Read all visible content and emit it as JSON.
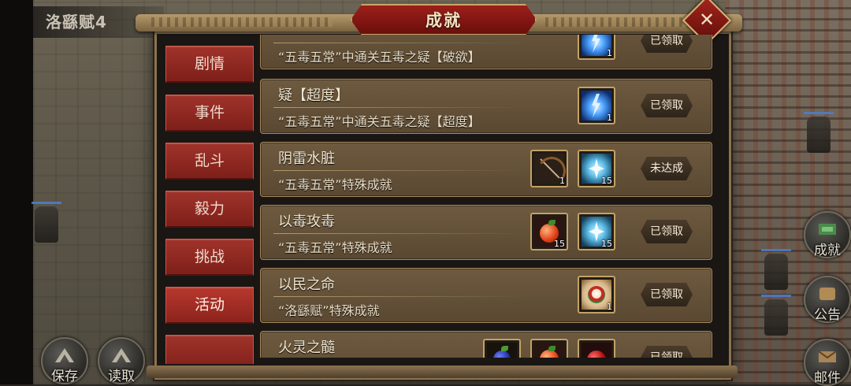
{
  "hud": {
    "map_title": "洛繇赋4",
    "save_label": "保存",
    "load_label": "读取",
    "achievement_label": "成就",
    "notice_label": "公告",
    "mail_label": "邮件"
  },
  "dialog": {
    "title": "成就",
    "close_icon": "close-x"
  },
  "tabs": [
    {
      "label": "剧情",
      "active": false
    },
    {
      "label": "事件",
      "active": false
    },
    {
      "label": "乱斗",
      "active": false
    },
    {
      "label": "毅力",
      "active": false
    },
    {
      "label": "挑战",
      "active": false
    },
    {
      "label": "活动",
      "active": true
    },
    {
      "label": "",
      "active": false
    }
  ],
  "achievements": [
    {
      "name": "",
      "desc": "“五毒五常”中通关五毒之疑【破欲】",
      "rewards": [
        {
          "icon": "lightning-icon",
          "count": "1"
        }
      ],
      "status": "已领取"
    },
    {
      "name": "疑【超度】",
      "desc": "“五毒五常”中通关五毒之疑【超度】",
      "rewards": [
        {
          "icon": "lightning-icon",
          "count": "1"
        }
      ],
      "status": "已领取"
    },
    {
      "name": "阴雷水脏",
      "desc": "“五毒五常”特殊成就",
      "rewards": [
        {
          "icon": "bow-icon",
          "count": "1"
        },
        {
          "icon": "crystal-icon",
          "count": "15"
        }
      ],
      "status": "未达成"
    },
    {
      "name": "以毒攻毒",
      "desc": "“五毒五常”特殊成就",
      "rewards": [
        {
          "icon": "fruit-icon",
          "count": "15"
        },
        {
          "icon": "crystal-icon",
          "count": "15"
        }
      ],
      "status": "已领取"
    },
    {
      "name": "以民之命",
      "desc": "“洛繇赋”特殊成就",
      "rewards": [
        {
          "icon": "lion-icon",
          "count": "1"
        }
      ],
      "status": "已领取"
    },
    {
      "name": "火灵之髓",
      "desc": "",
      "rewards": [
        {
          "icon": "berry-icon",
          "count": ""
        },
        {
          "icon": "fruit-icon",
          "count": ""
        },
        {
          "icon": "redfruit-icon",
          "count": ""
        }
      ],
      "status": "已领取"
    }
  ]
}
